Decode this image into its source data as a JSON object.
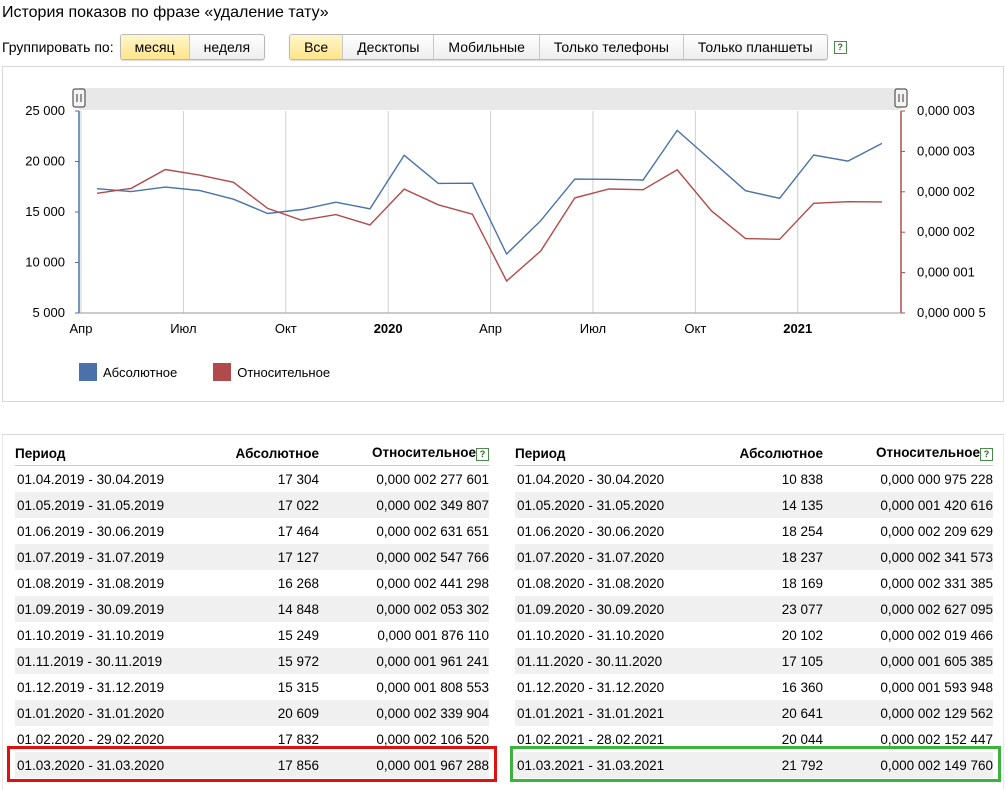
{
  "title": "История показов по фразе «удаление тату»",
  "grouping": {
    "label": "Группировать по:",
    "options": [
      "месяц",
      "неделя"
    ],
    "active": 0
  },
  "device_filter": {
    "options": [
      "Все",
      "Десктопы",
      "Мобильные",
      "Только телефоны",
      "Только планшеты"
    ],
    "active": 0,
    "help": "?"
  },
  "colors": {
    "absolute": "#4a72a8",
    "relative": "#b04b4b"
  },
  "chart_data": {
    "type": "line",
    "x": [
      "2019-04",
      "2019-05",
      "2019-06",
      "2019-07",
      "2019-08",
      "2019-09",
      "2019-10",
      "2019-11",
      "2019-12",
      "2020-01",
      "2020-02",
      "2020-03",
      "2020-04",
      "2020-05",
      "2020-06",
      "2020-07",
      "2020-08",
      "2020-09",
      "2020-10",
      "2020-11",
      "2020-12",
      "2021-01",
      "2021-02",
      "2021-03"
    ],
    "x_tick_labels": [
      "Апр",
      "Июл",
      "Окт",
      "2020",
      "Апр",
      "Июл",
      "Окт",
      "2021"
    ],
    "y_left": {
      "ticks": [
        "25 000",
        "20 000",
        "15 000",
        "10 000",
        "5 000"
      ],
      "range": [
        5000,
        25000
      ]
    },
    "y_right": {
      "ticks": [
        "0,000 003",
        "0,000 003",
        "0,000 002",
        "0,000 002",
        "0,000 001",
        "0,000 000 5"
      ],
      "range": [
        5e-07,
        3.5e-06
      ]
    },
    "series": [
      {
        "name": "Абсолютное",
        "axis": "left",
        "values": [
          17304,
          17022,
          17464,
          17127,
          16268,
          14848,
          15249,
          15972,
          15315,
          20609,
          17832,
          17856,
          10838,
          14135,
          18254,
          18237,
          18169,
          23077,
          20102,
          17105,
          16360,
          20641,
          20044,
          21792
        ]
      },
      {
        "name": "Относительное",
        "axis": "right",
        "values": [
          2.277601e-06,
          2.349807e-06,
          2.631651e-06,
          2.547766e-06,
          2.441298e-06,
          2.053302e-06,
          1.87611e-06,
          1.961241e-06,
          1.808553e-06,
          2.339904e-06,
          2.10652e-06,
          1.967288e-06,
          9.75228e-07,
          1.420616e-06,
          2.209629e-06,
          2.341573e-06,
          2.331385e-06,
          2.627095e-06,
          2.019466e-06,
          1.605385e-06,
          1.593948e-06,
          2.129562e-06,
          2.152447e-06,
          2.14976e-06
        ]
      }
    ]
  },
  "table": {
    "headers": {
      "period": "Период",
      "absolute": "Абсолютное",
      "relative": "Относительное"
    },
    "left": [
      [
        "01.04.2019 - 30.04.2019",
        "17 304",
        "0,000 002 277 601"
      ],
      [
        "01.05.2019 - 31.05.2019",
        "17 022",
        "0,000 002 349 807"
      ],
      [
        "01.06.2019 - 30.06.2019",
        "17 464",
        "0,000 002 631 651"
      ],
      [
        "01.07.2019 - 31.07.2019",
        "17 127",
        "0,000 002 547 766"
      ],
      [
        "01.08.2019 - 31.08.2019",
        "16 268",
        "0,000 002 441 298"
      ],
      [
        "01.09.2019 - 30.09.2019",
        "14 848",
        "0,000 002 053 302"
      ],
      [
        "01.10.2019 - 31.10.2019",
        "15 249",
        "0,000 001 876 110"
      ],
      [
        "01.11.2019 - 30.11.2019",
        "15 972",
        "0,000 001 961 241"
      ],
      [
        "01.12.2019 - 31.12.2019",
        "15 315",
        "0,000 001 808 553"
      ],
      [
        "01.01.2020 - 31.01.2020",
        "20 609",
        "0,000 002 339 904"
      ],
      [
        "01.02.2020 - 29.02.2020",
        "17 832",
        "0,000 002 106 520"
      ],
      [
        "01.03.2020 - 31.03.2020",
        "17 856",
        "0,000 001 967 288"
      ]
    ],
    "right": [
      [
        "01.04.2020 - 30.04.2020",
        "10 838",
        "0,000 000 975 228"
      ],
      [
        "01.05.2020 - 31.05.2020",
        "14 135",
        "0,000 001 420 616"
      ],
      [
        "01.06.2020 - 30.06.2020",
        "18 254",
        "0,000 002 209 629"
      ],
      [
        "01.07.2020 - 31.07.2020",
        "18 237",
        "0,000 002 341 573"
      ],
      [
        "01.08.2020 - 31.08.2020",
        "18 169",
        "0,000 002 331 385"
      ],
      [
        "01.09.2020 - 30.09.2020",
        "23 077",
        "0,000 002 627 095"
      ],
      [
        "01.10.2020 - 31.10.2020",
        "20 102",
        "0,000 002 019 466"
      ],
      [
        "01.11.2020 - 30.11.2020",
        "17 105",
        "0,000 001 605 385"
      ],
      [
        "01.12.2020 - 31.12.2020",
        "16 360",
        "0,000 001 593 948"
      ],
      [
        "01.01.2021 - 31.01.2021",
        "20 641",
        "0,000 002 129 562"
      ],
      [
        "01.02.2021 - 28.02.2021",
        "20 044",
        "0,000 002 152 447"
      ],
      [
        "01.03.2021 - 31.03.2021",
        "21 792",
        "0,000 002 149 760"
      ]
    ]
  }
}
